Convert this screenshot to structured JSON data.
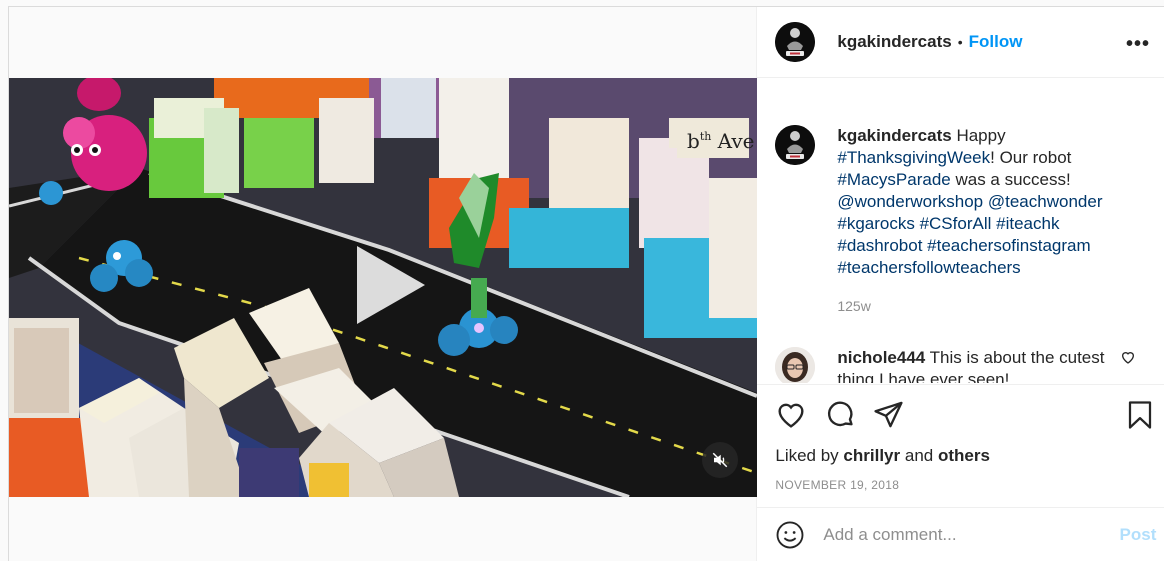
{
  "post": {
    "username": "kgakindercats",
    "follow_label": "Follow",
    "separator": "•",
    "more_label": "•••",
    "caption": {
      "username": "kgakindercats",
      "text_intro": "Happy",
      "line1_tag": "#ThanksgivingWeek",
      "line1_rest": "! Our robot",
      "line2_tag": "#MacysParade",
      "line2_rest": " was a success!",
      "line3_a": "@wonderworkshop",
      "line3_b": "@teachwonder",
      "line4_a": "#kgarocks",
      "line4_b": "#CSforAll",
      "line4_c": "#iteachk",
      "line5_a": "#dashrobot",
      "line5_b": "#teachersofinstagram",
      "line6_a": "#teachersfollowteachers",
      "age": "125w"
    },
    "comment": {
      "username": "nichole444",
      "text": "This is about the cutest thing I have ever seen!"
    },
    "likes": {
      "prefix": "Liked by",
      "user": "chrillyr",
      "joiner": "and",
      "others": "others"
    },
    "date": "NOVEMBER 19, 2018",
    "add_comment_placeholder": "Add a comment...",
    "post_label": "Post"
  },
  "icons": {
    "like": "heart-icon",
    "comment": "comment-icon",
    "share": "paper-plane-icon",
    "save": "bookmark-icon",
    "emoji": "smiley-icon",
    "mute": "muted-speaker-icon",
    "play": "play-icon"
  },
  "colors": {
    "accent": "#0095f6",
    "post_disabled": "#b2dffc",
    "hashtag": "#00376b"
  }
}
